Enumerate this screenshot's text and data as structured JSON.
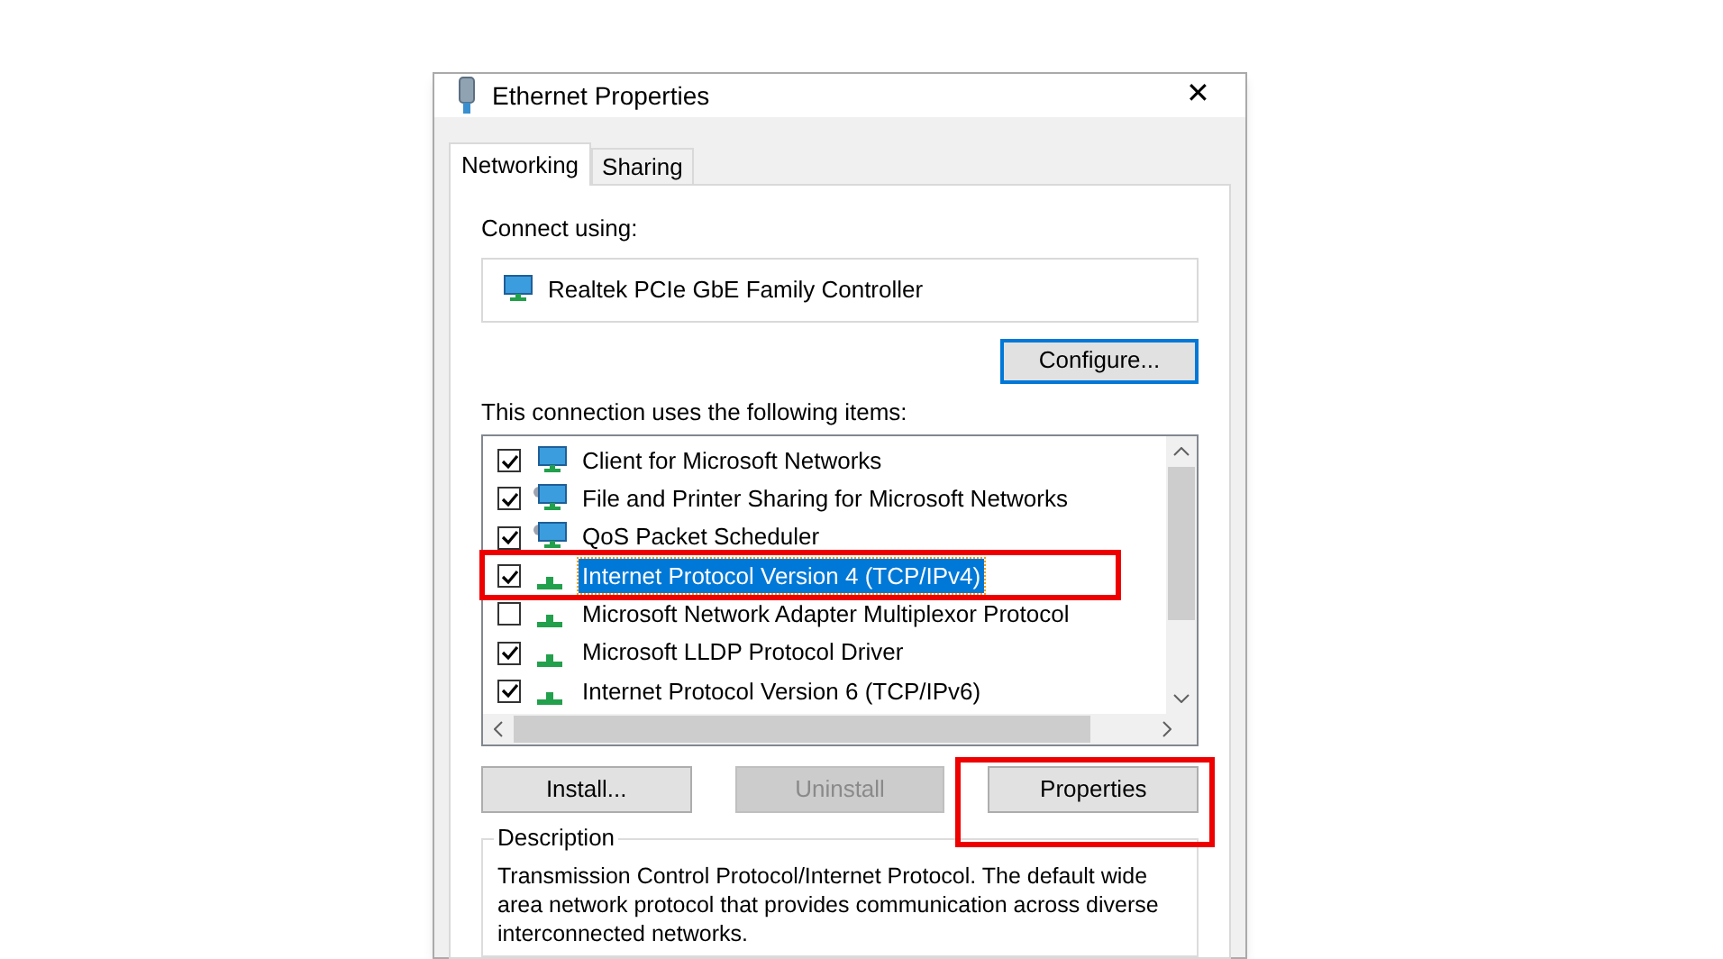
{
  "window": {
    "title": "Ethernet Properties",
    "close": "✕"
  },
  "tabs": [
    {
      "label": "Networking",
      "selected": true
    },
    {
      "label": "Sharing",
      "selected": false
    }
  ],
  "connect_using": {
    "label": "Connect using:",
    "adapter": "Realtek PCIe GbE Family Controller"
  },
  "configure_button": "Configure...",
  "items_label": "This connection uses the following items:",
  "items": [
    {
      "label": "Client for Microsoft Networks",
      "checked": true,
      "selected": false,
      "kind": "client"
    },
    {
      "label": "File and Printer Sharing for Microsoft Networks",
      "checked": true,
      "selected": false,
      "kind": "service"
    },
    {
      "label": "QoS Packet Scheduler",
      "checked": true,
      "selected": false,
      "kind": "service"
    },
    {
      "label": "Internet Protocol Version 4 (TCP/IPv4)",
      "checked": true,
      "selected": true,
      "kind": "protocol"
    },
    {
      "label": "Microsoft Network Adapter Multiplexor Protocol",
      "checked": false,
      "selected": false,
      "kind": "protocol"
    },
    {
      "label": "Microsoft LLDP Protocol Driver",
      "checked": true,
      "selected": false,
      "kind": "protocol"
    },
    {
      "label": "Internet Protocol Version 6 (TCP/IPv6)",
      "checked": true,
      "selected": false,
      "kind": "protocol"
    }
  ],
  "buttons": [
    {
      "label": "Install...",
      "disabled": false
    },
    {
      "label": "Uninstall",
      "disabled": true
    },
    {
      "label": "Properties",
      "disabled": false
    }
  ],
  "description": {
    "label": "Description",
    "text": "Transmission Control Protocol/Internet Protocol. The default wide area network protocol that provides communication across diverse interconnected networks."
  }
}
